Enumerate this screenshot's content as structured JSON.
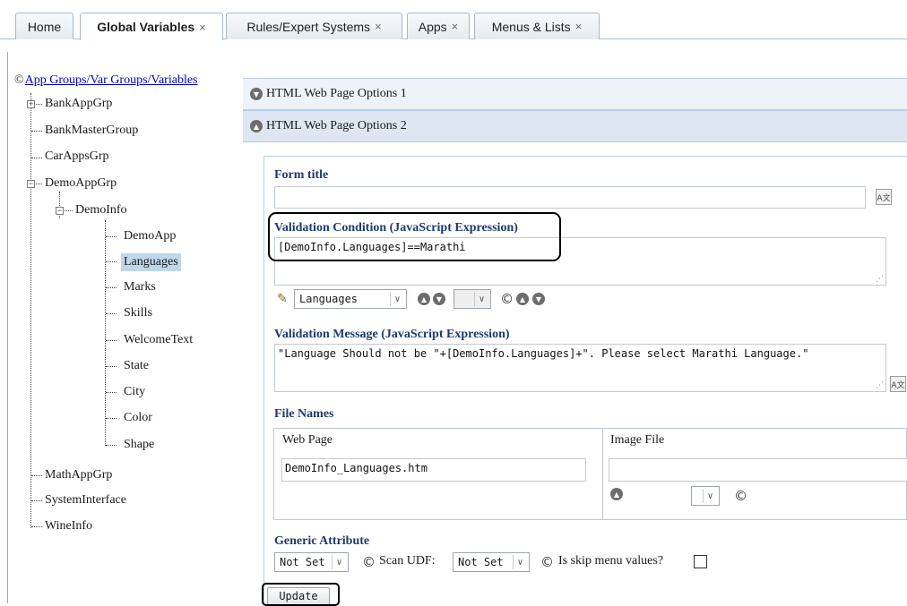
{
  "tabs": [
    {
      "label": "Home",
      "closable": false,
      "active": false
    },
    {
      "label": "Global Variables",
      "closable": true,
      "active": true
    },
    {
      "label": "Rules/Expert Systems",
      "closable": true,
      "active": false
    },
    {
      "label": "Apps",
      "closable": true,
      "active": false
    },
    {
      "label": "Menus & Lists",
      "closable": true,
      "active": false
    }
  ],
  "close_glyph": "×",
  "tree": {
    "root_label": "App Groups/Var Groups/Variables",
    "groups": [
      "BankAppGrp",
      "BankMasterGroup",
      "CarAppsGrp",
      "DemoAppGrp",
      "MathAppGrp",
      "SystemInterface",
      "WineInfo"
    ],
    "var_group": "DemoInfo",
    "variables": [
      "DemoApp",
      "Languages",
      "Marks",
      "Skills",
      "WelcomeText",
      "State",
      "City",
      "Color",
      "Shape"
    ],
    "selected": "Languages"
  },
  "sections": {
    "options1": "HTML Web Page Options 1",
    "options2": "HTML Web Page Options 2"
  },
  "form": {
    "form_title_label": "Form title",
    "form_title_value": "",
    "validation_condition_label": "Validation Condition (JavaScript Expression)",
    "validation_condition_value": "[DemoInfo.Languages]==Marathi",
    "variable_select": "Languages",
    "validation_message_label": "Validation Message (JavaScript Expression)",
    "validation_message_value": "\"Language Should not be \"+[DemoInfo.Languages]+\". Please select Marathi Language.\"",
    "file_names_label": "File Names",
    "web_page_label": "Web Page",
    "web_page_value": "DemoInfo_Languages.htm",
    "image_file_label": "Image File",
    "image_file_value": "",
    "generic_attribute_label": "Generic Attribute",
    "generic_attribute_value": "Not Set",
    "scan_udf_label": "Scan UDF:",
    "scan_udf_value": "Not Set",
    "skip_menu_label": "Is skip menu values?",
    "skip_menu_checked": false,
    "update_button": "Update"
  },
  "icons": {
    "refresh_glyph": "©",
    "caret_glyph": "∨",
    "expand_glyph": "+",
    "collapse_glyph": "−",
    "up_glyph": "▲",
    "down_glyph": "▼",
    "pencil_glyph": "✎",
    "translate_glyph": "A文",
    "resize_glyph": "⋰"
  }
}
